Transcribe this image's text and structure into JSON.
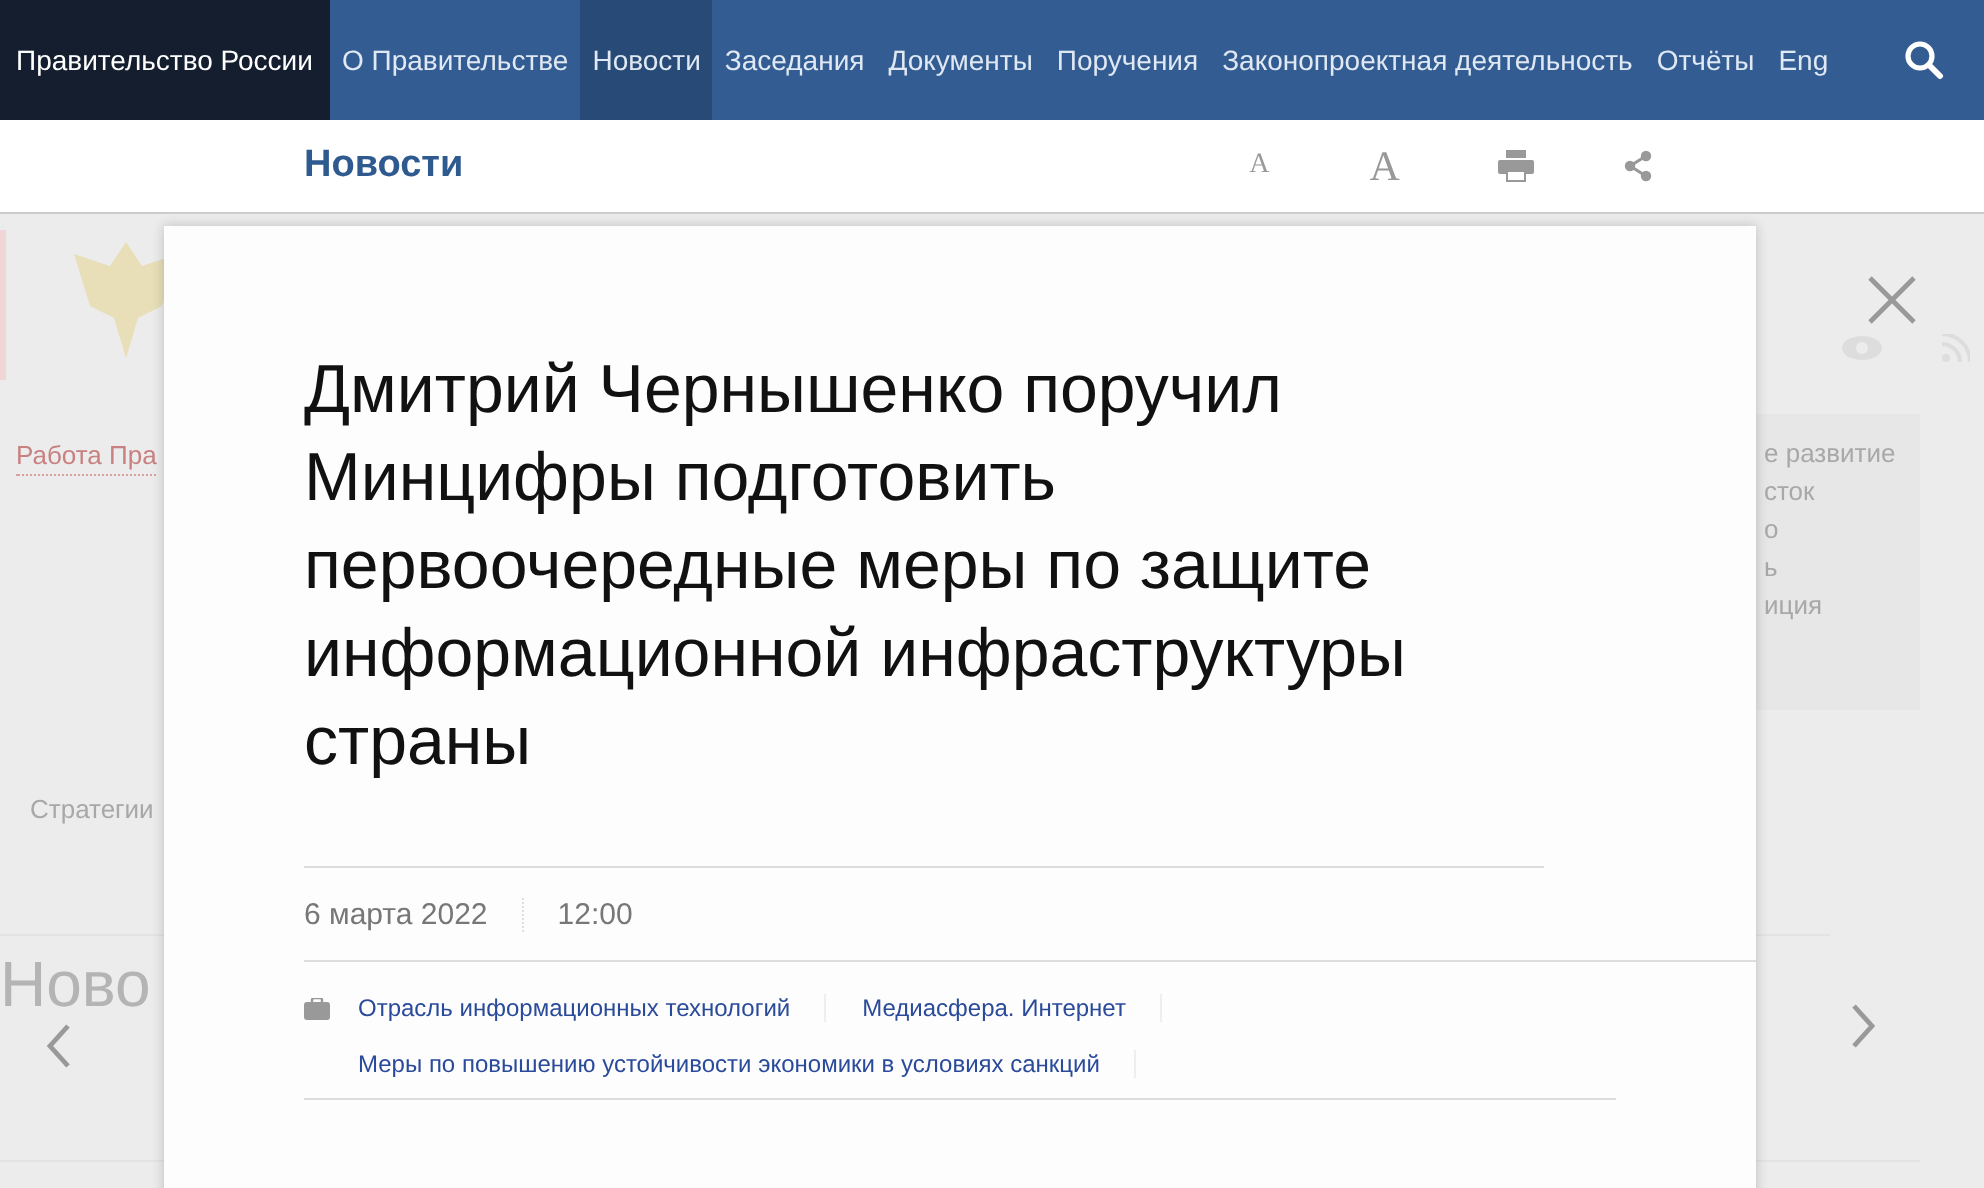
{
  "topbar": {
    "brand": "Правительство России",
    "nav": [
      {
        "label": "О Правительстве",
        "selected": false
      },
      {
        "label": "Новости",
        "selected": true
      },
      {
        "label": "Заседания",
        "selected": false
      },
      {
        "label": "Документы",
        "selected": false
      },
      {
        "label": "Поручения",
        "selected": false
      },
      {
        "label": "Законопроектная деятельность",
        "selected": false
      },
      {
        "label": "Отчёты",
        "selected": false
      },
      {
        "label": "Eng",
        "selected": false
      }
    ]
  },
  "subheader": {
    "title": "Новости",
    "font_small": "A",
    "font_large": "A"
  },
  "background": {
    "left_link": "Работа Пра",
    "right_list": [
      "е развитие",
      "сток",
      "о",
      "ь",
      "иция"
    ],
    "strategy": "Стратегии",
    "news_heading": "Ново"
  },
  "article": {
    "title": "Дмитрий Чернышенко поручил Минцифры подготовить первоочередные меры по защите информационной инфраструктуры страны",
    "date": "6 марта 2022",
    "time": "12:00",
    "tags": [
      [
        "Отрасль информационных технологий",
        "Медиасфера. Интернет"
      ],
      [
        "Меры по повышению устойчивости экономики в условиях санкций"
      ]
    ]
  }
}
